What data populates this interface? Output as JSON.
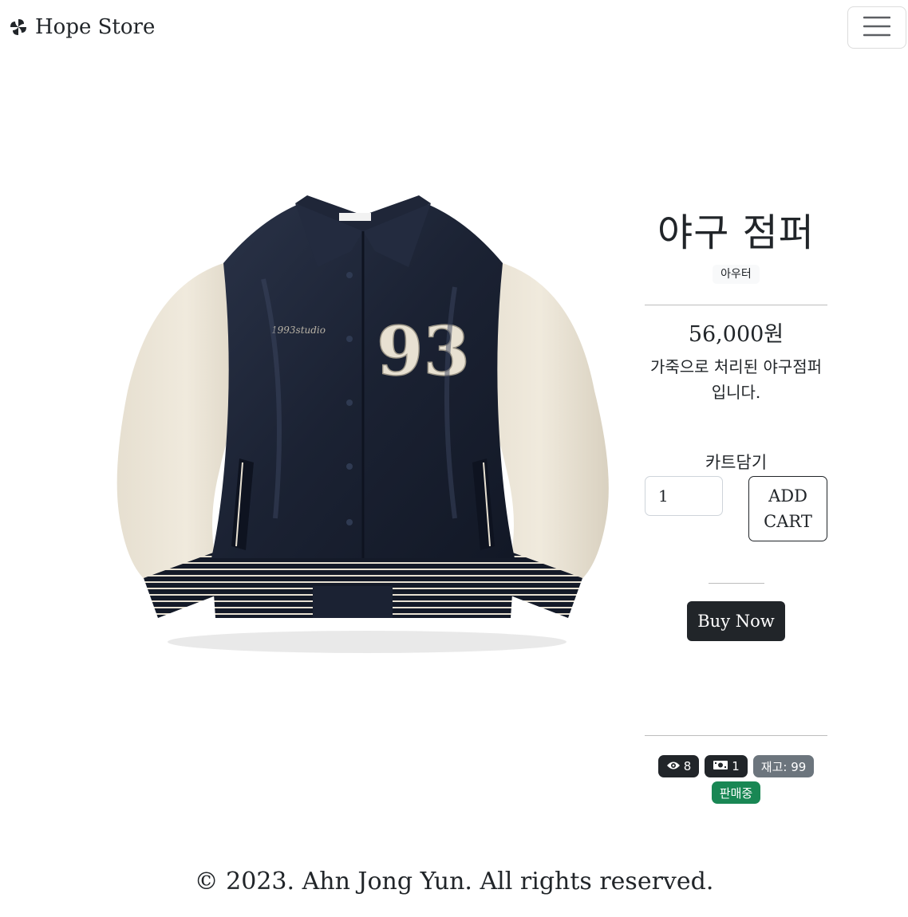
{
  "navbar": {
    "brand_name": "Hope Store",
    "brand_icon": "pinwheel-icon",
    "menu_icon": "hamburger-menu-icon"
  },
  "product": {
    "image_alt": "야구 점퍼",
    "title": "야구 점퍼",
    "category": "아우터",
    "price": "56,000원",
    "description": "가죽으로 처리된 야구점퍼 입니다."
  },
  "cart": {
    "label": "카트담기",
    "quantity_value": "1",
    "add_button_label": "ADD CART"
  },
  "buy": {
    "button_label": "Buy Now"
  },
  "stats": {
    "views_icon": "eye-icon",
    "views": "8",
    "sales_icon": "money-icon",
    "sales": "1",
    "stock_label": "재고: 99",
    "status": "판매중"
  },
  "footer": {
    "copyright": "© 2023. Ahn Jong Yun. All rights reserved."
  },
  "colors": {
    "dark": "#212529",
    "gray_badge": "#6c757d",
    "green_badge": "#198754",
    "jacket_body": "#1b2233",
    "jacket_sleeve": "#e8e1d2"
  }
}
